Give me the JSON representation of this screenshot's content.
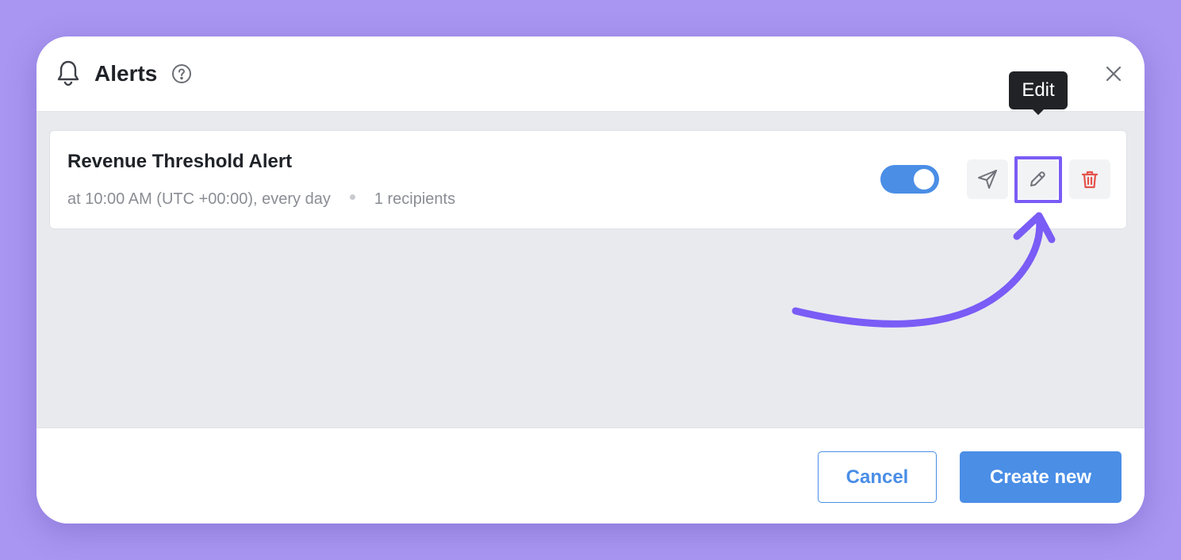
{
  "dialog": {
    "title": "Alerts",
    "icons": [
      "bell-icon",
      "help-icon",
      "close-icon"
    ]
  },
  "alert": {
    "name": "Revenue Threshold Alert",
    "schedule": "at 10:00 AM (UTC +00:00), every day",
    "recipients": "1 recipients",
    "enabled": true,
    "actions": [
      "send-icon",
      "pencil-icon",
      "trash-icon"
    ]
  },
  "tooltip": {
    "text": "Edit"
  },
  "footer": {
    "cancel_label": "Cancel",
    "create_label": "Create new"
  },
  "colors": {
    "background": "#a996f2",
    "accent": "#4a8ee6",
    "highlight": "#7a5cf6",
    "delete": "#e5534b"
  }
}
